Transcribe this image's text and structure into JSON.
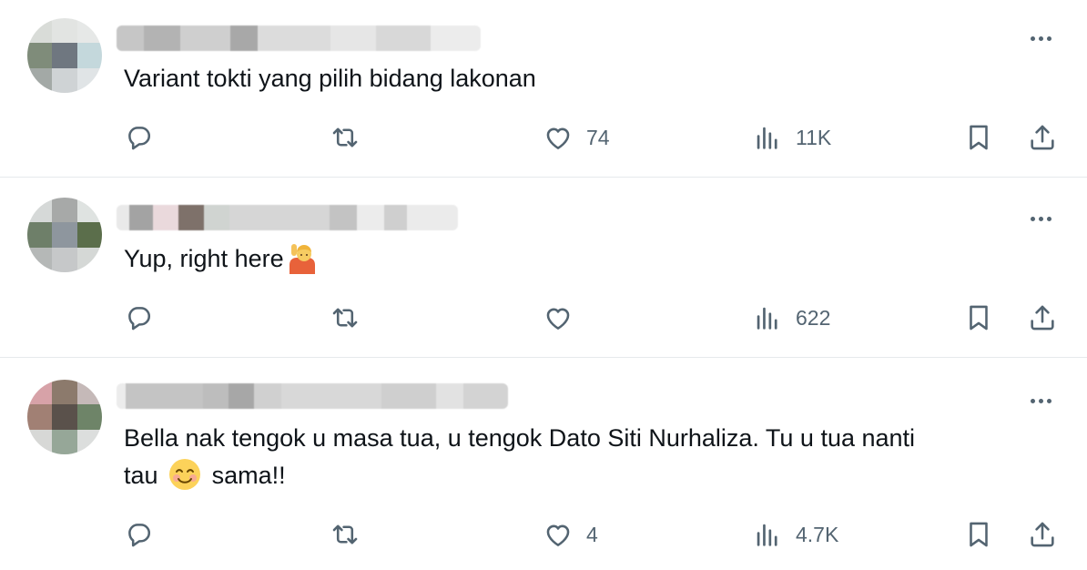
{
  "colors": {
    "icon": "#536471",
    "text": "#0f1419",
    "divider": "#e6e9ec"
  },
  "replies": [
    {
      "text": "Variant tokti yang pilih bidang lakonan",
      "emoji": "",
      "stats": {
        "replies": "",
        "reposts": "",
        "likes": "74",
        "views": "11K"
      }
    },
    {
      "text": "Yup, right here",
      "emoji": "person-raising-hand",
      "stats": {
        "replies": "",
        "reposts": "",
        "likes": "",
        "views": "622"
      }
    },
    {
      "text_line1": "Bella nak tengok u masa tua, u tengok Dato Siti Nurhaliza. Tu u tua nanti",
      "text_line2a": "tau",
      "text_line2b": "sama!!",
      "emoji": "smiling-face-with-smiling-eyes",
      "stats": {
        "replies": "",
        "reposts": "",
        "likes": "4",
        "views": "4.7K"
      }
    }
  ],
  "icons": [
    "reply-icon",
    "repost-icon",
    "like-icon",
    "views-icon",
    "bookmark-icon",
    "share-icon",
    "more-icon"
  ]
}
